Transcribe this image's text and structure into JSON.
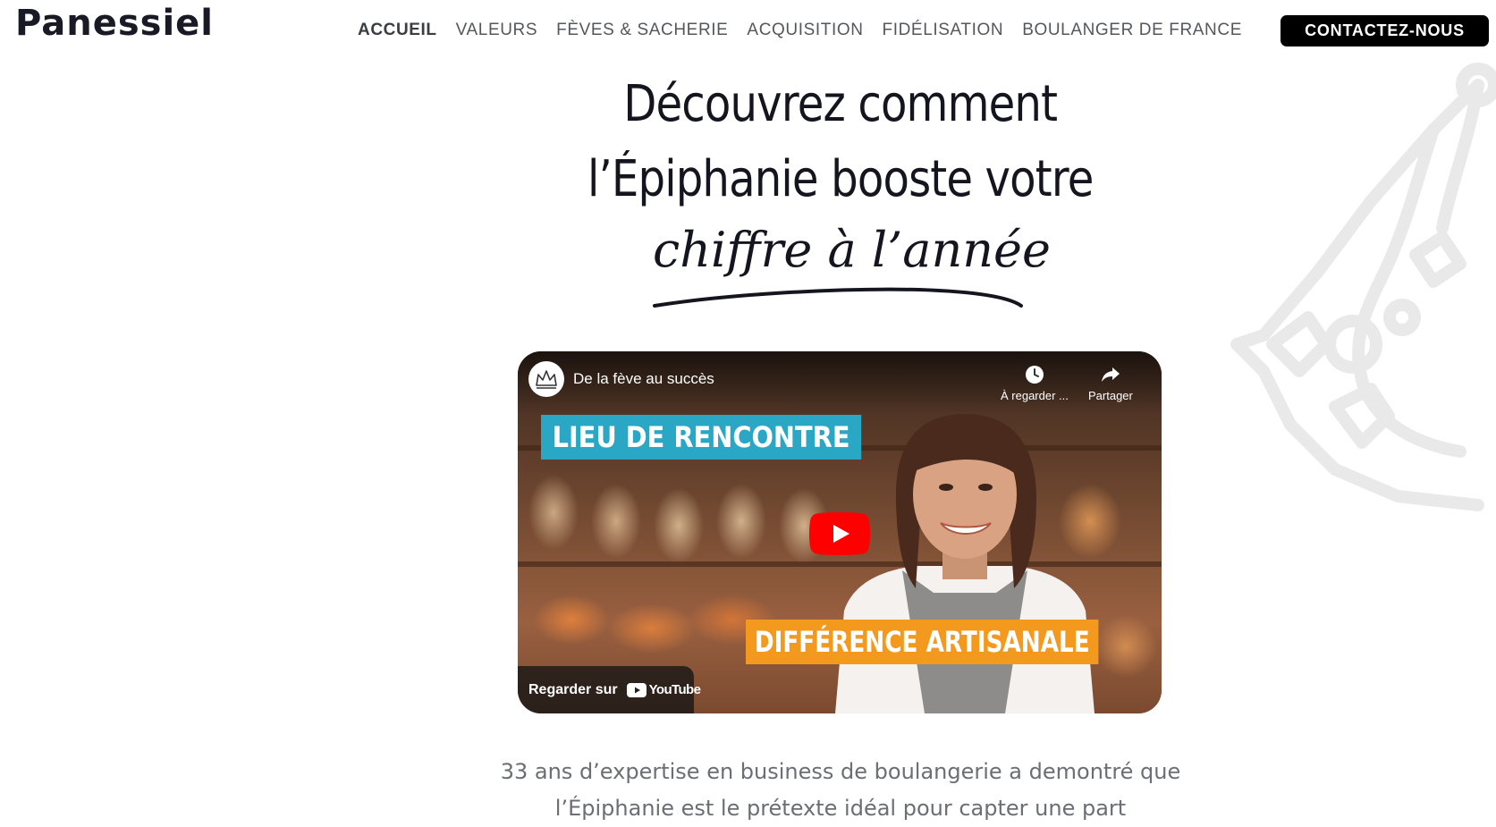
{
  "header": {
    "logo": "Panessiel",
    "nav": [
      {
        "label": "ACCUEIL",
        "active": true
      },
      {
        "label": "VALEURS",
        "active": false
      },
      {
        "label": "FÈVES & SACHERIE",
        "active": false
      },
      {
        "label": "ACQUISITION",
        "active": false
      },
      {
        "label": "FIDÉLISATION",
        "active": false
      },
      {
        "label": "BOULANGER DE FRANCE",
        "active": false
      }
    ],
    "cta_label": "CONTACTEZ-NOUS"
  },
  "hero": {
    "line1": "Découvrez comment",
    "line2": "l’Épiphanie booste votre",
    "script_line": "chiffre à l’année"
  },
  "video": {
    "title": "De la fève au succès",
    "watch_later_label": "À regarder ...",
    "share_label": "Partager",
    "banner_top": "LIEU DE RENCONTRE",
    "banner_bottom": "DIFFÉRENCE ARTISANALE",
    "watch_on_label": "Regarder sur",
    "youtube_label": "YouTube",
    "icons": [
      "clock-icon",
      "share-arrow-icon",
      "play-icon",
      "youtube-icon",
      "crown-logo-icon"
    ]
  },
  "intro": {
    "line1": "33 ans d’expertise en business de boulangerie a demontré que",
    "line2": "l’Épiphanie est le prétexte idéal pour capter une part"
  },
  "colors": {
    "nav_text": "#55575c",
    "cta_bg": "#000000",
    "banner_top_bg": "#2aa7c5",
    "banner_bottom_bg": "#f39a1e",
    "youtube_red": "#ff0000",
    "heading": "#15151f",
    "intro_text": "#6b6e73"
  }
}
